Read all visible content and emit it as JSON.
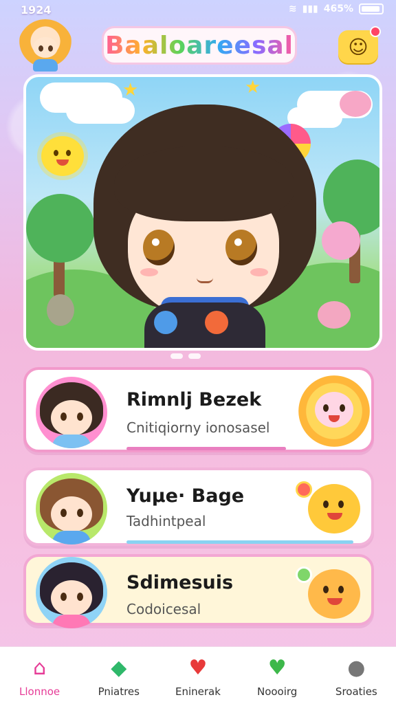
{
  "status_bar": {
    "time": "1924",
    "battery": "465%"
  },
  "header": {
    "app_title": "Baaloareesal",
    "notification_icon": "smiley-icon"
  },
  "cards": [
    {
      "title": "Rimnlj Bezek",
      "subtitle": "Cnitiqiorny ionosasel",
      "bar_color": "#e97fc0",
      "border": "#f29acb",
      "bg": "#ffffff"
    },
    {
      "title": "Yuµe· Bage",
      "subtitle": "Tadhintpeal",
      "bar_color": "#8ad2f2",
      "border": "#f2b3d9",
      "bg": "#ffffff"
    },
    {
      "title": "Sdimesuis",
      "subtitle": "Codoicesal",
      "bar_color": "#f7d57d",
      "border": "#f2a7d3",
      "bg": "#fff6d9"
    }
  ],
  "nav": [
    {
      "label": "Llonnoe",
      "icon": "home-icon"
    },
    {
      "label": "Pniatres",
      "icon": "leaf-icon"
    },
    {
      "label": "Eninerak",
      "icon": "heart-icon"
    },
    {
      "label": "Noooirg",
      "icon": "heart-check-icon"
    },
    {
      "label": "Sroaties",
      "icon": "user-icon"
    }
  ],
  "colors": {
    "accent": "#e63c97",
    "logo_bg": "#fff6fa",
    "smile_button": "#ffd64a"
  }
}
